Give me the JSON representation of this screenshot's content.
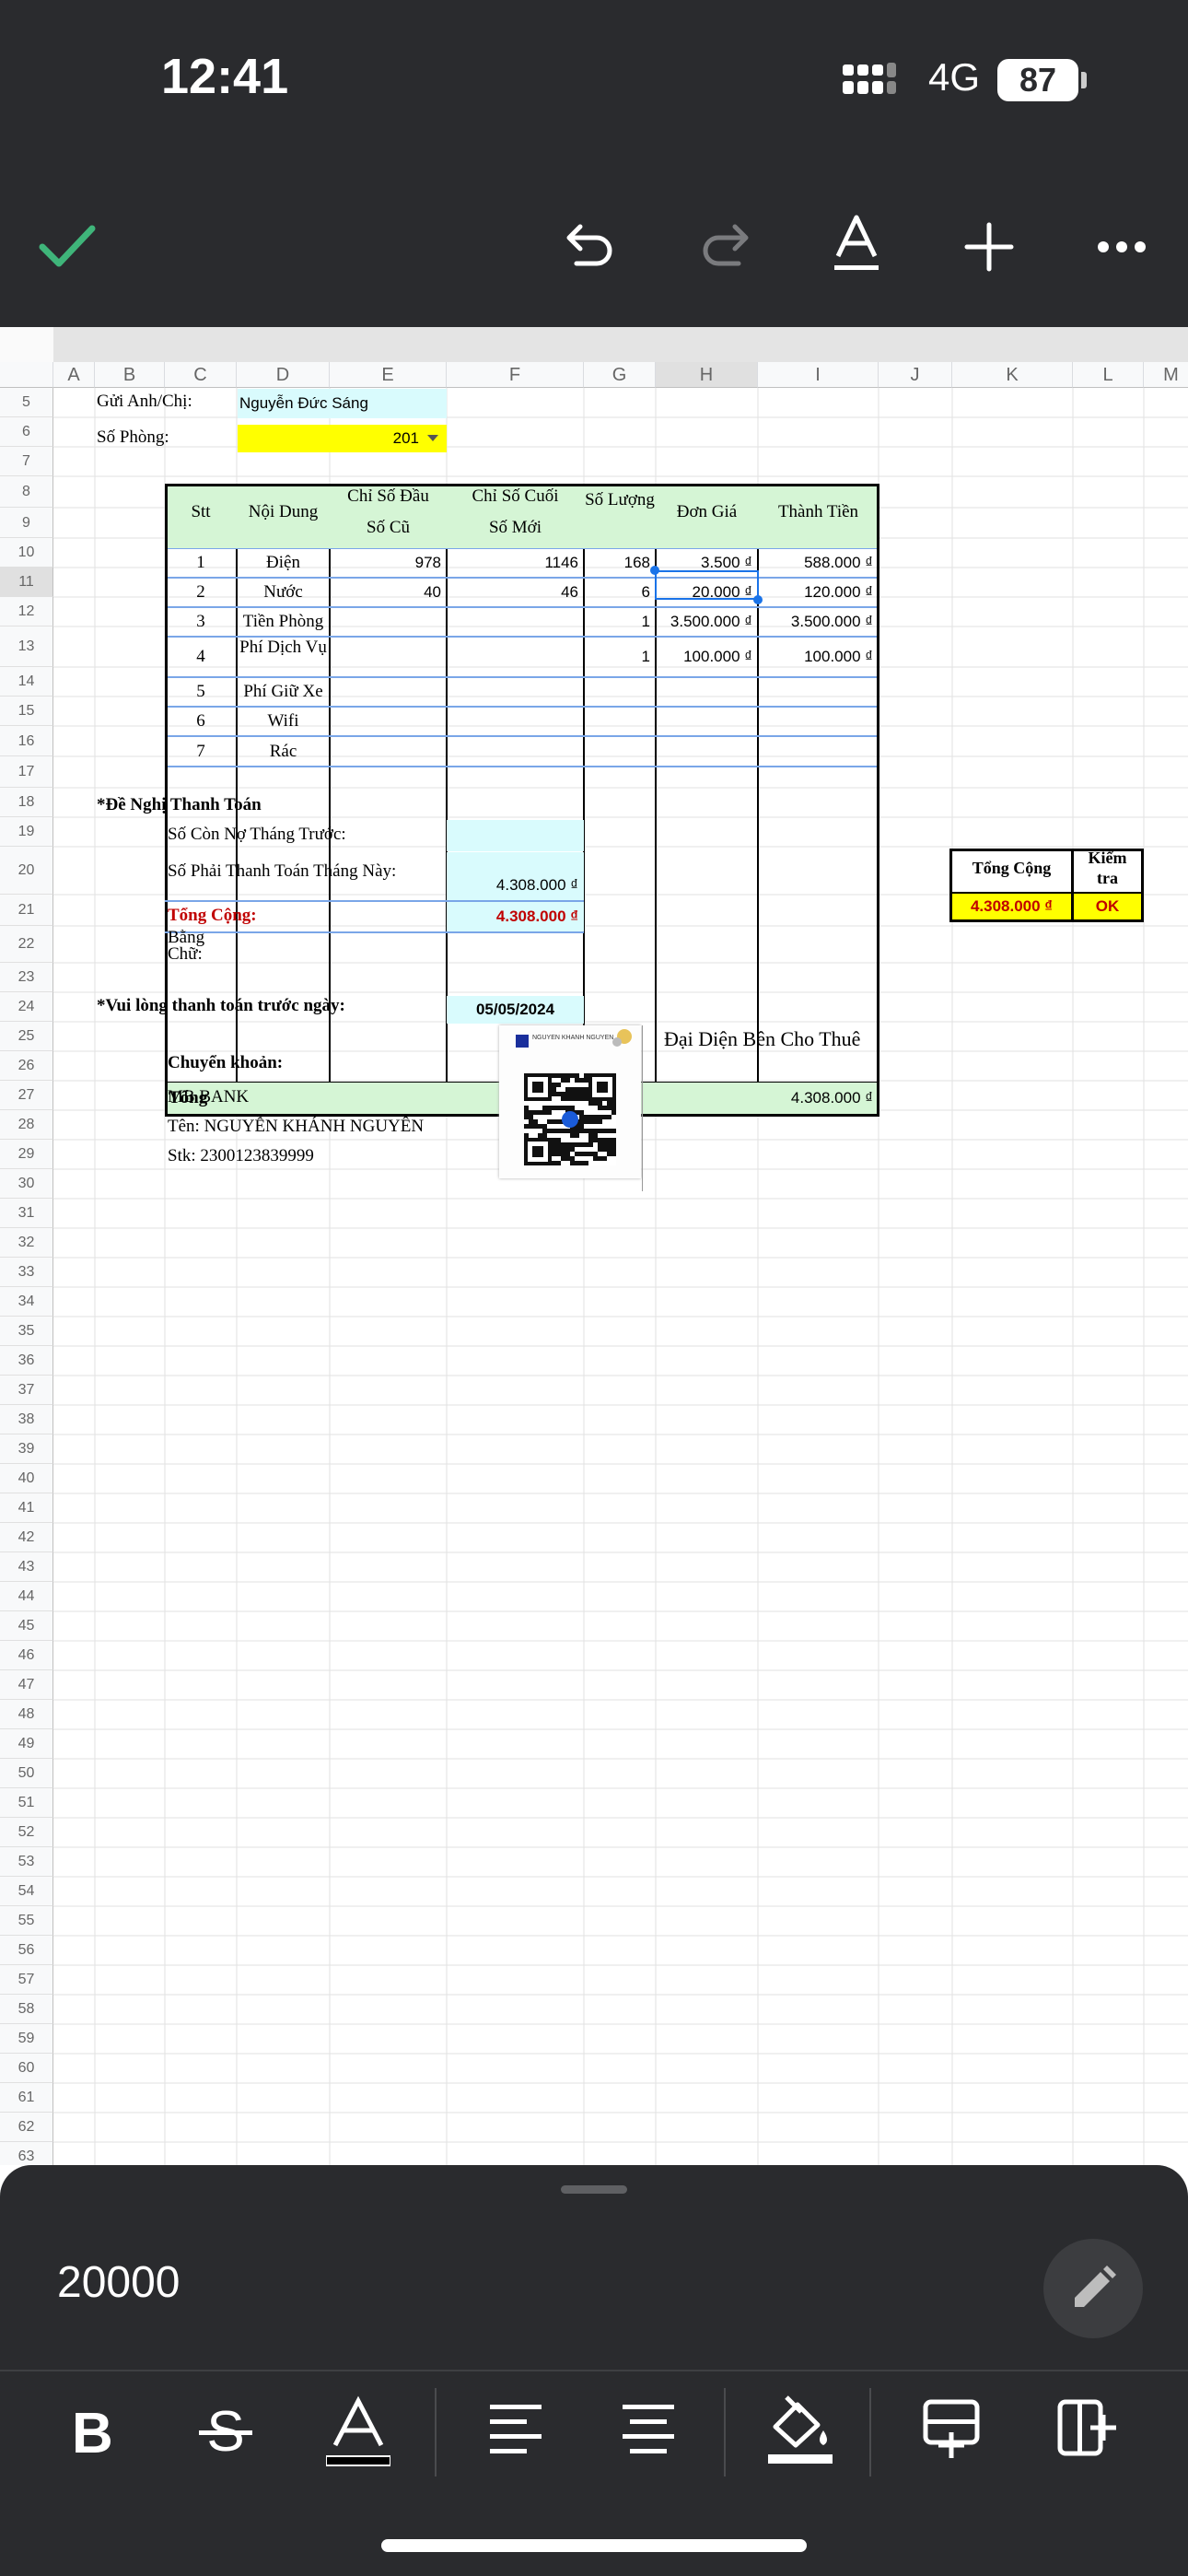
{
  "status_bar": {
    "time": "12:41",
    "network": "4G",
    "battery": "87"
  },
  "toolbar": {
    "icons": [
      "checkmark-icon",
      "undo-icon",
      "redo-icon",
      "text-format-icon",
      "insert-plus-icon",
      "more-icon"
    ]
  },
  "columns": [
    "A",
    "B",
    "C",
    "D",
    "E",
    "F",
    "G",
    "H",
    "I",
    "J",
    "K",
    "L",
    "M"
  ],
  "rows": [
    "5",
    "6",
    "7",
    "8",
    "9",
    "10",
    "11",
    "12",
    "13",
    "14",
    "15",
    "16",
    "17",
    "18",
    "19",
    "20",
    "21",
    "22",
    "23",
    "24",
    "25",
    "26",
    "27",
    "28",
    "29",
    "30",
    "31",
    "32",
    "33",
    "34",
    "35",
    "36",
    "37",
    "38",
    "39",
    "40",
    "41",
    "42",
    "43",
    "44",
    "45",
    "46",
    "47",
    "48",
    "49",
    "50",
    "51",
    "52",
    "53",
    "54",
    "55",
    "56",
    "57",
    "58",
    "59",
    "60",
    "61",
    "62",
    "63"
  ],
  "header_info": {
    "recipient_label": "Gửi Anh/Chị:",
    "recipient_name": "Nguyễn Đức Sáng",
    "room_label": "Số Phòng:",
    "room_value": "201"
  },
  "table": {
    "headers": {
      "stt": "Stt",
      "content": "Nội Dung",
      "start_reading": "Chỉ Số Đầu",
      "old_reading": "Số Cũ",
      "end_reading": "Chỉ Số Cuối",
      "new_reading": "Số Mới",
      "quantity": "Số Lượng",
      "unit_price": "Đơn Giá",
      "amount": "Thành Tiền"
    },
    "rows": [
      {
        "stt": "1",
        "content": "Điện",
        "old": "978",
        "new": "1146",
        "qty": "168",
        "price": "3.500 ₫",
        "amount": "588.000 ₫"
      },
      {
        "stt": "2",
        "content": "Nước",
        "old": "40",
        "new": "46",
        "qty": "6",
        "price": "20.000 ₫",
        "amount": "120.000 ₫"
      },
      {
        "stt": "3",
        "content": "Tiền Phòng",
        "old": "",
        "new": "",
        "qty": "1",
        "price": "3.500.000 ₫",
        "amount": "3.500.000 ₫"
      },
      {
        "stt": "4",
        "content": "Phí Dịch Vụ",
        "old": "",
        "new": "",
        "qty": "1",
        "price": "100.000 ₫",
        "amount": "100.000 ₫"
      },
      {
        "stt": "5",
        "content": "Phí Giữ Xe",
        "old": "",
        "new": "",
        "qty": "",
        "price": "",
        "amount": ""
      },
      {
        "stt": "6",
        "content": "Wifi",
        "old": "",
        "new": "",
        "qty": "",
        "price": "",
        "amount": ""
      },
      {
        "stt": "7",
        "content": "Rác",
        "old": "",
        "new": "",
        "qty": "",
        "price": "",
        "amount": ""
      }
    ],
    "total_label": "Tổng",
    "total_amount": "4.308.000 ₫"
  },
  "payment": {
    "section_title": "*Đề Nghị Thanh Toán",
    "previous_debt_label": "Số Còn Nợ Tháng Trước:",
    "this_month_label": "Số Phải Thanh Toán Tháng Này:",
    "this_month_value": "4.308.000 ₫",
    "grand_total_label": "Tổng Cộng:",
    "grand_total_value": "4.308.000 ₫",
    "in_words_label_1": "Bằng",
    "in_words_label_2": "Chữ:",
    "due_label": "*Vui lòng thanh toán trước ngày:",
    "due_date": "05/05/2024",
    "transfer_label": "Chuyển khoản:",
    "bank": "MB BANK",
    "account_name": "Tên: NGUYỄN KHÁNH NGUYÊN",
    "account_number": "Stk: 2300123839999",
    "qr_name": "NGUYEN KHANH NGUYEN",
    "representative": "Đại Diện Bên Cho Thuê"
  },
  "check_box": {
    "total_header": "Tổng Cộng",
    "check_header_1": "Kiểm",
    "check_header_2": "tra",
    "total_value": "4.308.000 ₫",
    "check_value": "OK"
  },
  "editor": {
    "cell_value": "20000"
  },
  "format_bar": {
    "icons": [
      "bold-icon",
      "strikethrough-icon",
      "text-color-icon",
      "align-left-icon",
      "align-center-icon",
      "fill-color-icon",
      "insert-row-icon",
      "insert-column-icon"
    ]
  },
  "colors": {
    "background_dark": "#2a2b2e",
    "header_fill": "#d5f5d5",
    "cyan_fill": "#d9fbfd",
    "yellow_fill": "#ffff00",
    "accent_red": "#c00000",
    "check_green": "#3fb57a"
  }
}
